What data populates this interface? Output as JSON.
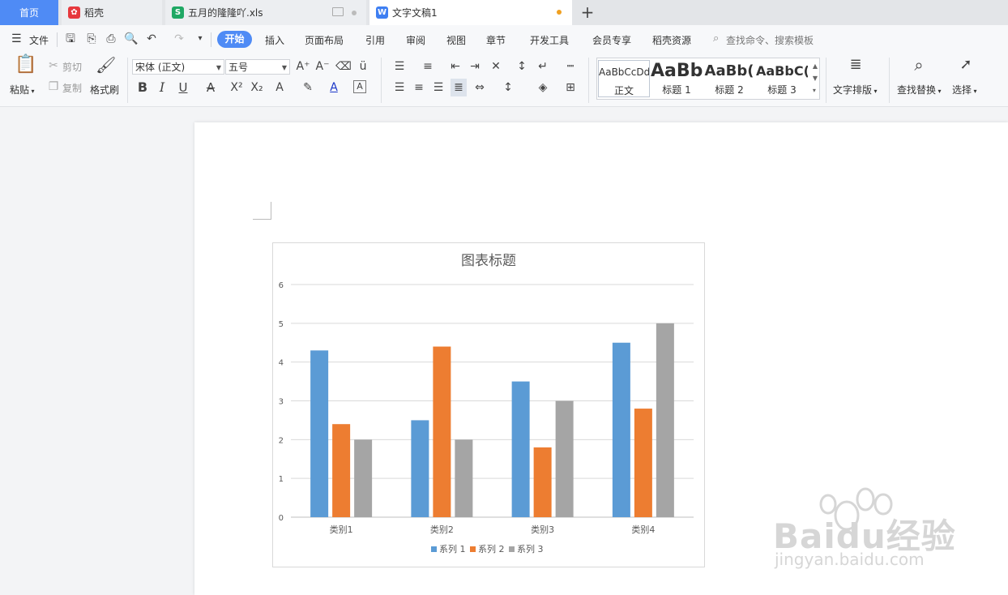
{
  "tabs": {
    "home": "首页",
    "daoke": "稻壳",
    "xls": "五月的隆隆吖.xls",
    "doc": "文字文稿1",
    "add": "+"
  },
  "menu": {
    "file": "文件",
    "items": [
      "开始",
      "插入",
      "页面布局",
      "引用",
      "审阅",
      "视图",
      "章节",
      "开发工具",
      "会员专享",
      "稻壳资源"
    ],
    "search_placeholder": "查找命令、搜索模板"
  },
  "ribbon": {
    "paste": "粘贴",
    "cut": "剪切",
    "copy": "复制",
    "format_painter": "格式刷",
    "font_name": "宋体 (正文)",
    "font_size": "五号",
    "styles": [
      {
        "preview": "AaBbCcDd",
        "label": "正文"
      },
      {
        "preview": "AaBb",
        "label": "标题 1"
      },
      {
        "preview": "AaBb(",
        "label": "标题 2"
      },
      {
        "preview": "AaBbC(",
        "label": "标题 3"
      }
    ],
    "text_layout": "文字排版",
    "find_replace": "查找替换",
    "select": "选择"
  },
  "colors": {
    "accent": "#4f8bf5",
    "series1": "#5b9bd5",
    "series2": "#ed7d31",
    "series3": "#a5a5a5",
    "modified_dot": "#f0a020"
  },
  "chart_data": {
    "type": "bar",
    "title": "图表标题",
    "categories": [
      "类别1",
      "类别2",
      "类别3",
      "类别4"
    ],
    "series": [
      {
        "name": "系列 1",
        "values": [
          4.3,
          2.5,
          3.5,
          4.5
        ]
      },
      {
        "name": "系列 2",
        "values": [
          2.4,
          4.4,
          1.8,
          2.8
        ]
      },
      {
        "name": "系列 3",
        "values": [
          2,
          2,
          3,
          5
        ]
      }
    ],
    "ylim": [
      0,
      6
    ],
    "yticks": [
      "0",
      "1",
      "2",
      "3",
      "4",
      "5",
      "6"
    ],
    "grid": true,
    "legend": "bottom"
  },
  "watermark": {
    "brand": "Baidu经验",
    "url": "jingyan.baidu.com"
  }
}
